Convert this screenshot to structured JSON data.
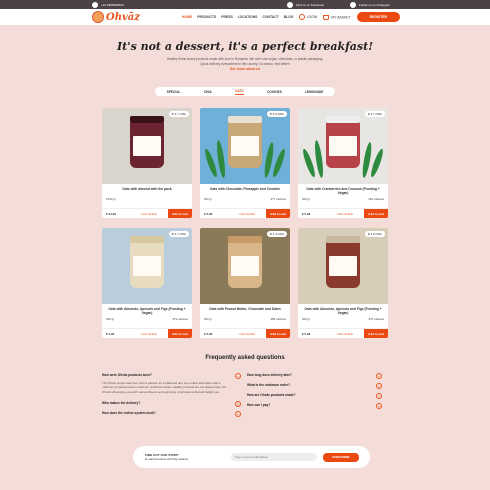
{
  "topbar": {
    "phone": "+91 9999999524",
    "facebook": "Find us on Facebook",
    "instagram": "Follow us on Instagram"
  },
  "nav": {
    "logo": "Ohvāz",
    "menu": [
      "HOME",
      "PRODUCTS",
      "PRESS",
      "LOCATIONS",
      "CONTACT",
      "BLOG"
    ],
    "login": "LOGIN",
    "basket": "MY BASKET",
    "register": "REGISTER"
  },
  "hero": {
    "title": "It's not a dessert, it's a perfect breakfast!",
    "line1": "Healthy finest snack products made with love in Romania. We don't use sugar, chemicals, or plastic packaging.",
    "line2": "Quick delivery everywhere in the country. Go lemon, feel better!",
    "more": "See more about us"
  },
  "tabs": [
    "SPECIAL",
    "CHIA",
    "OATS",
    "COOKIES",
    "LEMONADE"
  ],
  "products": [
    {
      "title": "Oats with almond with the pack",
      "weight": "1500 gr",
      "calories": "",
      "price": "€ 24,99",
      "rating": "4.7 (100)",
      "details": "View details",
      "add": "Add to cart",
      "jar": "#6b2430",
      "lid": "#3a1218",
      "bg": "#d9d4cc"
    },
    {
      "title": "Oats with Chocolate, Pineapple and Crumble",
      "weight": "300 gr",
      "calories": "377 calories",
      "price": "€ 5,99",
      "rating": "4.8 (350)",
      "details": "View details",
      "add": "Add to cart",
      "jar": "#c9a877",
      "lid": "#e8e0d0",
      "bg": "#6fb0d8"
    },
    {
      "title": "Oats with Cranberries and Coconut (Frosting + Vegan)",
      "weight": "300 gr",
      "calories": "381 calories",
      "price": "€ 5,99",
      "rating": "4.7 (350)",
      "details": "View details",
      "add": "Add to cart",
      "jar": "#b8424a",
      "lid": "#eee",
      "bg": "#e8e6e2"
    },
    {
      "title": "Oats with Almonds, Apricots and Figs (Frosting + Vegan)",
      "weight": "300 gr",
      "calories": "379 calories",
      "price": "€ 5,99",
      "rating": "4.7 (281)",
      "details": "View details",
      "add": "Add to cart",
      "jar": "#e8dcc0",
      "lid": "#d8c8a0",
      "bg": "#b9cddc"
    },
    {
      "title": "Oats with Peanut Butter, Chocolate and Dates",
      "weight": "300 gr",
      "calories": "386 calories",
      "price": "€ 5,99",
      "rating": "4.4 (262)",
      "details": "View details",
      "add": "Add to cart",
      "jar": "#d9b58a",
      "lid": "#c79a66",
      "bg": "#8a7a5a"
    },
    {
      "title": "Oats with Almonds, Apricots and Figs (Frosting + Vegan)",
      "weight": "300 gr",
      "calories": "375 calories",
      "price": "€ 5,99",
      "rating": "4.8 (281)",
      "details": "View details",
      "add": "Add to cart",
      "jar": "#8a3a2c",
      "lid": "#c8b8a0",
      "bg": "#d8cdb8"
    }
  ],
  "faq": {
    "title": "Frequently asked questions",
    "left": [
      {
        "q": "How were Ohvāz products born?",
        "a": "The Ohvāz project was born from a passion for a balanced diet, as a snack alternative with a minimum of calories and a maximum nutritional intake. Healthy products are not always tasty, but Ohvāz will surprise you with various flavors and surprising combinations that will delight you.",
        "toggle": "−"
      },
      {
        "q": "Who makes the delivery?",
        "a": "",
        "toggle": "+"
      },
      {
        "q": "How does the review system work?",
        "a": "",
        "toggle": "+"
      }
    ],
    "right": [
      {
        "q": "How long does delivery take?",
        "toggle": "+"
      },
      {
        "q": "What is the minimum order?",
        "toggle": "+"
      },
      {
        "q": "How are Ohvāz products made?",
        "toggle": "+"
      },
      {
        "q": "How can I pay?",
        "toggle": "+"
      }
    ]
  },
  "newsletter": {
    "title": "FIND OUT OUR STORY",
    "subtitle": "E-mail luxurious with big dreams",
    "placeholder": "Type in your email adress",
    "button": "SUBSCRIBE"
  }
}
